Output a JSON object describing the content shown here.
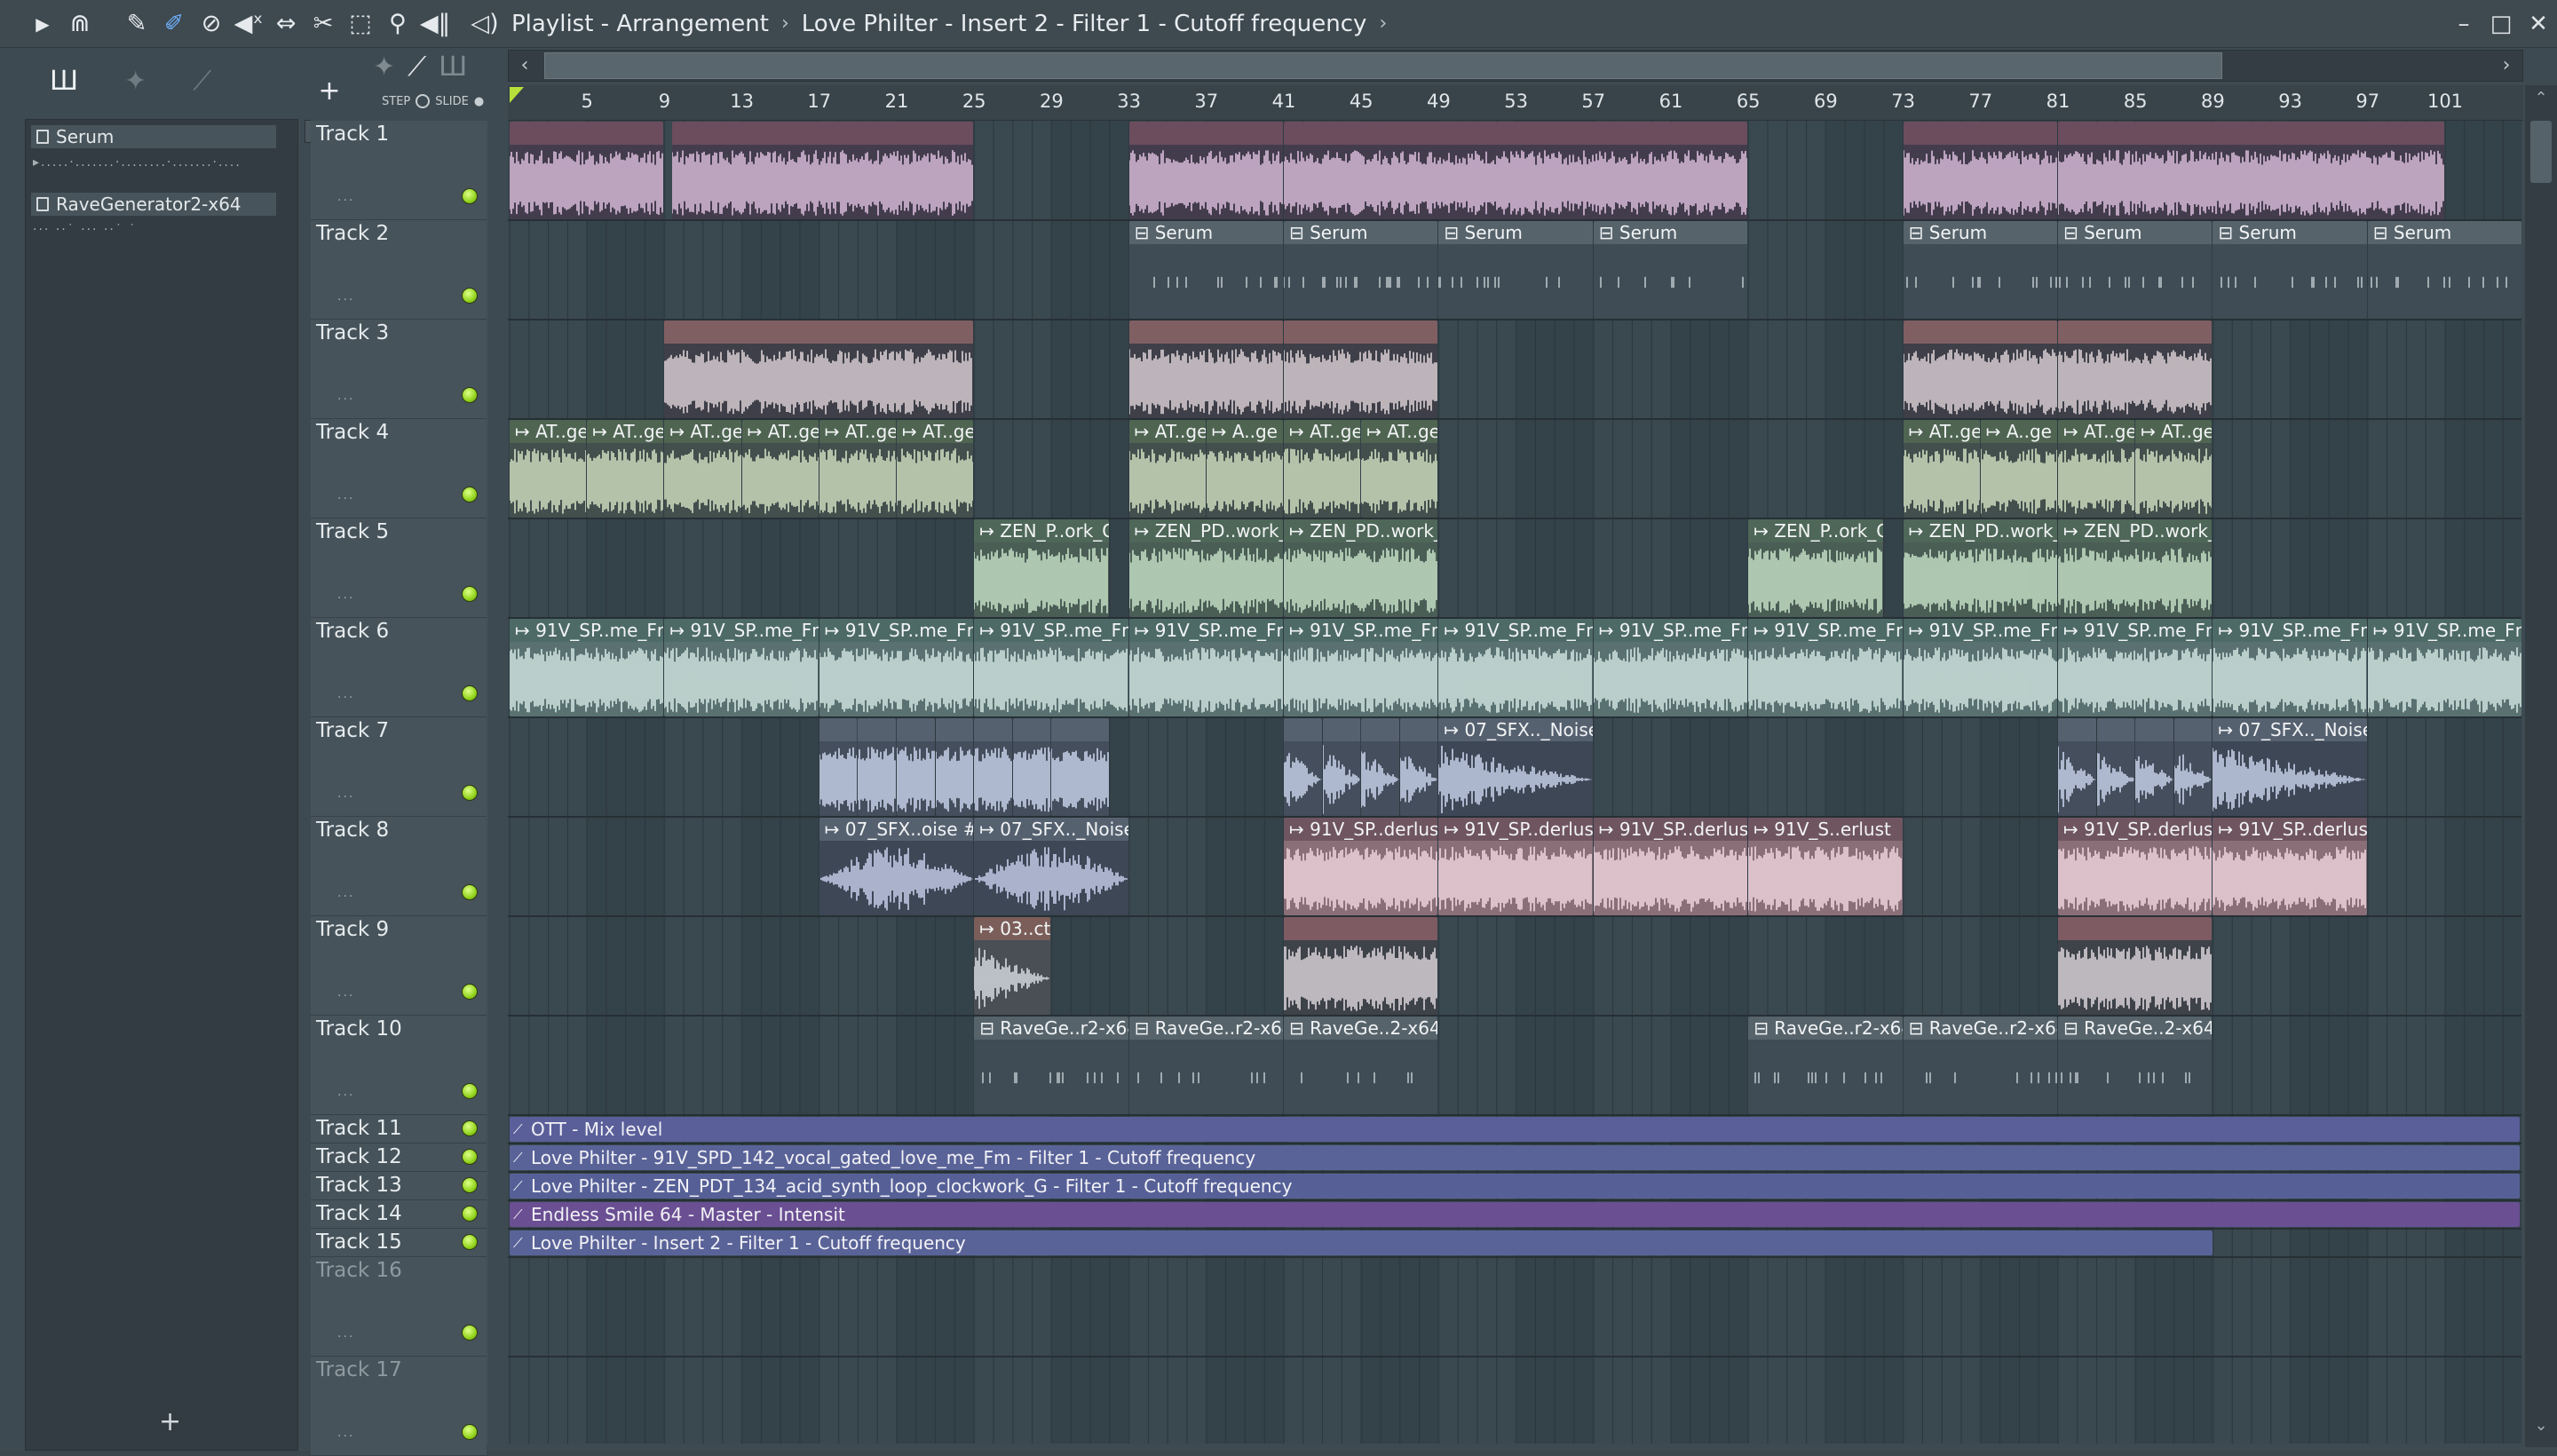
{
  "window": {
    "title_parts": [
      "Playlist - Arrangement",
      "Love Philter - Insert 2 - Filter 1 - Cutoff frequency"
    ],
    "controls": [
      "–",
      "□",
      "✕"
    ]
  },
  "toolbar_icons": [
    "play-arrow-icon",
    "magnet-icon",
    "pencil-icon",
    "paint-brush-icon",
    "delete-icon",
    "mute-icon",
    "slip-icon",
    "slice-icon",
    "select-icon",
    "zoom-icon",
    "playback-icon",
    "volume-icon"
  ],
  "browser": {
    "channels": [
      {
        "name": "Serum",
        "sub": "▸.....·.......·........·.......·...."
      },
      {
        "name": "RaveGenerator2-x64",
        "sub": "···   ··˙   ···   ··˙    ˙"
      }
    ],
    "add_label": "+"
  },
  "header_toolbar": {
    "add": "+",
    "step": "STEP",
    "slide": "SLIDE"
  },
  "ruler": {
    "bars": [
      "5",
      "9",
      "13",
      "17",
      "21",
      "25",
      "29",
      "33",
      "37",
      "41",
      "45",
      "49",
      "53",
      "57",
      "61",
      "65",
      "69",
      "73",
      "77",
      "81",
      "85",
      "89",
      "93",
      "97",
      "101"
    ]
  },
  "tracks": [
    {
      "name": "Track 1",
      "dim": false
    },
    {
      "name": "Track 2",
      "dim": false
    },
    {
      "name": "Track 3",
      "dim": false
    },
    {
      "name": "Track 4",
      "dim": false
    },
    {
      "name": "Track 5",
      "dim": false
    },
    {
      "name": "Track 6",
      "dim": false
    },
    {
      "name": "Track 7",
      "dim": false
    },
    {
      "name": "Track 8",
      "dim": false
    },
    {
      "name": "Track 9",
      "dim": false
    },
    {
      "name": "Track 10",
      "dim": false
    },
    {
      "name": "Track 11",
      "dim": false
    },
    {
      "name": "Track 12",
      "dim": false
    },
    {
      "name": "Track 13",
      "dim": false
    },
    {
      "name": "Track 14",
      "dim": false
    },
    {
      "name": "Track 15",
      "dim": false
    },
    {
      "name": "Track 16",
      "dim": true
    },
    {
      "name": "Track 17",
      "dim": true
    }
  ],
  "clip_labels": {
    "t2": [
      "Serum",
      "Serum",
      "Serum",
      "Serum",
      "Serum",
      "Serum",
      "Serum",
      "Serum"
    ],
    "t4": [
      "AT..ge",
      "AT..ge",
      "AT..ge",
      "AT..ge",
      "AT..ge",
      "AT..ge",
      "AT..ge",
      "A..ge",
      "AT..ge",
      "AT..ge",
      "AT..ge",
      "A..ge",
      "AT..ge",
      "AT..ge"
    ],
    "t5": [
      "ZEN_P..ork_G",
      "ZEN_PD..work_G",
      "ZEN_PD..work_G",
      "ZEN_P..ork_G",
      "ZEN_PD..work_G",
      "ZEN_PD..work_G"
    ],
    "t6": "91V_SP..me_Fm",
    "t7": [
      "07_SFX.._Noise",
      "07_SFX.._Noise"
    ],
    "t8": [
      "07_SFX..oise #2",
      "07_SFX.._Noise",
      "91V_SP..derlust",
      "91V_SP..derlust",
      "91V_SP..derlust",
      "91V_S..erlust",
      "91V_SP..derlust",
      "91V_SP..derlust"
    ],
    "t9": [
      "03..ct"
    ],
    "t10": [
      "RaveGe..r2-x64",
      "RaveGe..r2-x64",
      "RaveGe..2-x64",
      "RaveGe..r2-x64",
      "RaveGe..r2-x64",
      "RaveGe..2-x64"
    ]
  },
  "automation": [
    {
      "label": "OTT - Mix level",
      "color": "#5a5f9a"
    },
    {
      "label": "Love Philter - 91V_SPD_142_vocal_gated_love_me_Fm - Filter 1 - Cutoff frequency",
      "color": "#5a6398"
    },
    {
      "label": "Love Philter - ZEN_PDT_134_acid_synth_loop_clockwork_G - Filter 1 - Cutoff frequency",
      "color": "#566097"
    },
    {
      "label": "Endless Smile 64 - Master - Intensit",
      "color": "#6a4f93"
    },
    {
      "label": "Love Philter - Insert 2 - Filter 1 - Cutoff frequency",
      "color": "#5a6398"
    }
  ]
}
